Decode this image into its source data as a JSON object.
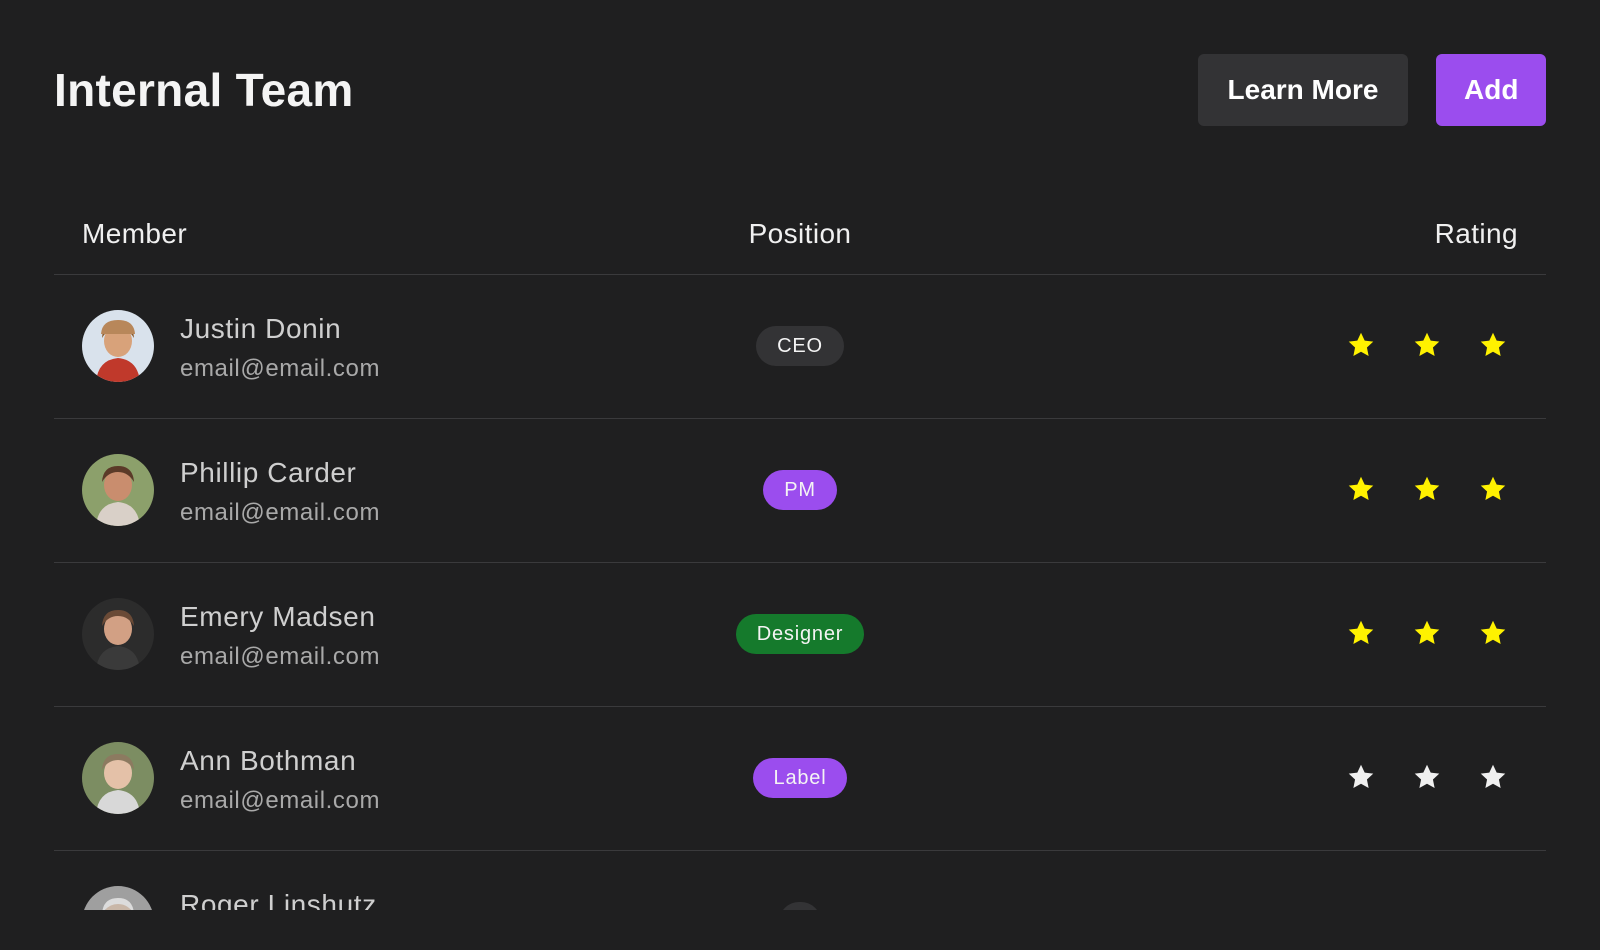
{
  "header": {
    "title": "Internal Team",
    "learn_more_label": "Learn More",
    "add_label": "Add"
  },
  "table": {
    "columns": [
      "Member",
      "Position",
      "Rating"
    ],
    "rows": [
      {
        "name": "Justin Donin",
        "email": "email@email.com",
        "position": "CEO",
        "position_color": "#333335",
        "rating": 3,
        "star_color": "#fff200"
      },
      {
        "name": "Phillip Carder",
        "email": "email@email.com",
        "position": "PM",
        "position_color": "#9b4dee",
        "rating": 3,
        "star_color": "#fff200"
      },
      {
        "name": "Emery Madsen",
        "email": "email@email.com",
        "position": "Designer",
        "position_color": "#157a2c",
        "rating": 3,
        "star_color": "#fff200"
      },
      {
        "name": "Ann Bothman",
        "email": "email@email.com",
        "position": "Label",
        "position_color": "#9b4dee",
        "rating": 0,
        "star_color": "#f0f0f0"
      },
      {
        "name": "Roger Linshutz",
        "email": "",
        "position": "",
        "position_color": "#333335",
        "rating": 0,
        "star_color": "#f0f0f0"
      }
    ]
  },
  "colors": {
    "background": "#1f1f20",
    "accent": "#9b4dee",
    "secondary_button": "#333335",
    "divider": "#3a3a3c"
  },
  "icons": {
    "avatar": "avatar-photo",
    "rating": "star-icon"
  }
}
